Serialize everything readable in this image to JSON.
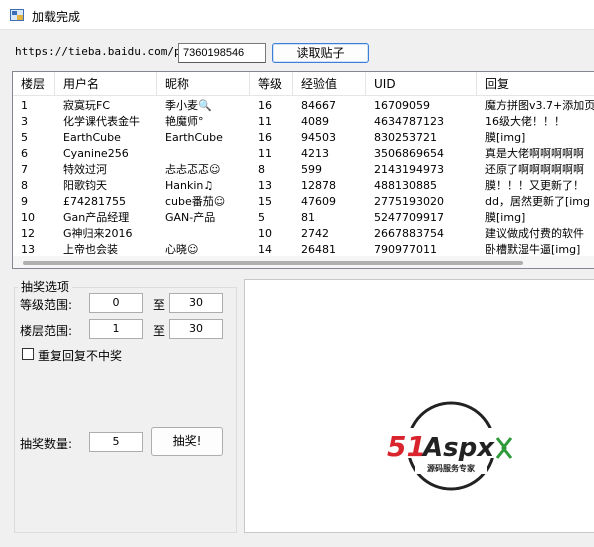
{
  "window": {
    "title": "加载完成"
  },
  "topbar": {
    "url_prefix": "https://tieba.baidu.com/p/",
    "thread_id": "7360198546",
    "read_button": "读取贴子"
  },
  "table": {
    "columns": [
      "楼层",
      "用户名",
      "昵称",
      "等级",
      "经验值",
      "UID",
      "回复"
    ],
    "rows": [
      [
        "1",
        "寂寞玩FC",
        "季小麦🔍",
        "16",
        "84667",
        "16709059",
        "魔方拼图v3.7+添加页"
      ],
      [
        "3",
        "化学课代表金牛",
        "艳魔师°",
        "11",
        "4089",
        "4634787123",
        "16级大佬！！！"
      ],
      [
        "5",
        "EarthCube",
        "EarthCube",
        "16",
        "94503",
        "830253721",
        "膜[img]"
      ],
      [
        "6",
        "Cyanine256",
        "",
        "11",
        "4213",
        "3506869654",
        "真是大佬啊啊啊啊啊"
      ],
      [
        "7",
        "特效过河",
        "忐忐忑忑☺",
        "8",
        "599",
        "2143194973",
        "还原了啊啊啊啊啊啊"
      ],
      [
        "8",
        "阳歌钧天",
        "Hankin♫",
        "13",
        "12878",
        "488130885",
        "膜！！！又更新了！"
      ],
      [
        "9",
        "£74281755",
        "cube番茄☺",
        "15",
        "47609",
        "2775193020",
        "dd，居然更新了[img"
      ],
      [
        "10",
        "Gan产品经理",
        "GAN-产品",
        "5",
        "81",
        "5247709917",
        "膜[img]"
      ],
      [
        "12",
        "G神归来2016",
        "",
        "10",
        "2742",
        "2667883754",
        "建议做成付费的软件"
      ],
      [
        "13",
        "上帝也会装",
        "心晓☺",
        "14",
        "26481",
        "790977011",
        "卧槽默湿牛逼[img]"
      ]
    ]
  },
  "options": {
    "title": "抽奖选项",
    "level_label": "等级范围:",
    "level_from": "0",
    "level_to": "30",
    "floor_label": "楼层范围:",
    "floor_from": "1",
    "floor_to": "30",
    "to_label": "至",
    "repeat_label": "重复回复不中奖",
    "count_label": "抽奖数量:",
    "count": "5",
    "draw_button": "抽奖!"
  },
  "logo": {
    "brand": "51Aspx",
    "tagline": "源码服务专家",
    "colors": {
      "red": "#d9232d",
      "green": "#2f9a3a",
      "dark": "#222222"
    }
  }
}
